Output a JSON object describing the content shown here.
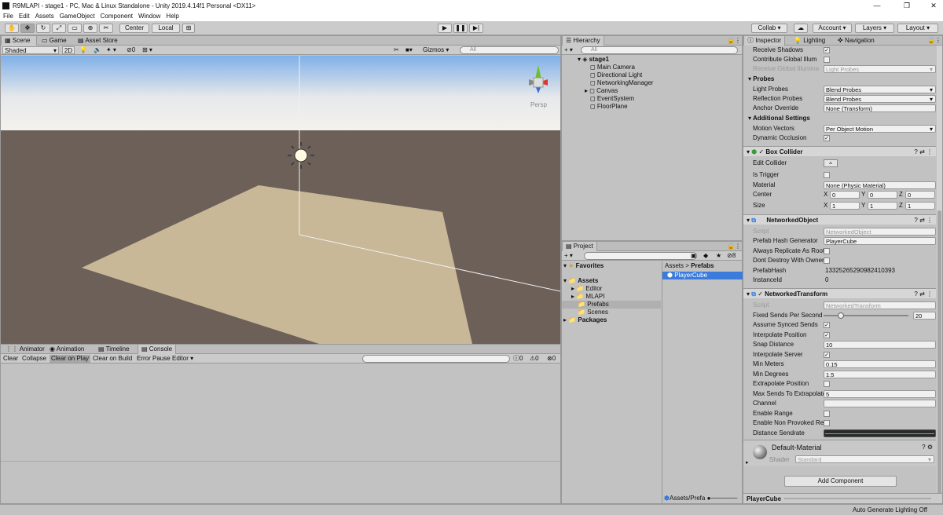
{
  "window": {
    "title": "R9MLAPI - stage1 - PC, Mac & Linux Standalone - Unity 2019.4.14f1 Personal <DX11>",
    "minimize": "—",
    "maximize": "❐",
    "close": "✕"
  },
  "menu": [
    "File",
    "Edit",
    "Assets",
    "GameObject",
    "Component",
    "Window",
    "Help"
  ],
  "toolbar": {
    "center_label": "Center",
    "local_label": "Local",
    "collab_label": "Collab",
    "account_label": "Account",
    "layers_label": "Layers",
    "layout_label": "Layout"
  },
  "scene": {
    "tabs": [
      "Scene",
      "Game",
      "Asset Store"
    ],
    "shading": "Shaded",
    "mode2d": "2D",
    "hidden_count": "0",
    "gizmos": "Gizmos",
    "search_placeholder": "All",
    "persp": "Persp",
    "colors": {
      "sky": "#e6e8ea",
      "ground": "#6c6059",
      "floor": "#c8b898"
    }
  },
  "console": {
    "tabs": [
      "Animator",
      "Animation",
      "Timeline",
      "Console"
    ],
    "buttons": [
      "Clear",
      "Collapse",
      "Clear on Play",
      "Clear on Build",
      "Error Pause",
      "Editor"
    ],
    "info_count": "0",
    "warn_count": "0",
    "error_count": "0"
  },
  "hierarchy": {
    "tab": "Hierarchy",
    "search_placeholder": "All",
    "scene_name": "stage1",
    "items": [
      "Main Camera",
      "Directional Light",
      "NetworkingManager",
      "Canvas",
      "EventSystem",
      "FloorPlane"
    ]
  },
  "project": {
    "tab": "Project",
    "hidden_count": "8",
    "favorites": "Favorites",
    "assets": "Assets",
    "folders": [
      "Editor",
      "MLAPI",
      "Prefabs",
      "Scenes"
    ],
    "packages": "Packages",
    "breadcrumb": [
      "Assets",
      "Prefabs"
    ],
    "selected_item": "PlayerCube",
    "footer_path": "Assets/Prefa"
  },
  "inspector": {
    "tabs": [
      "Inspector",
      "Lighting",
      "Navigation"
    ],
    "renderer_rows": [
      {
        "label": "Receive Shadows",
        "type": "check",
        "value": "✓"
      },
      {
        "label": "Contribute Global Illum",
        "type": "check",
        "value": ""
      },
      {
        "label": "Receive Global Illumina",
        "type": "dropdown",
        "value": "Light Probes",
        "disabled": true
      }
    ],
    "probes": {
      "title": "Probes",
      "light_probes_label": "Light Probes",
      "light_probes_value": "Blend Probes",
      "reflection_probes_label": "Reflection Probes",
      "reflection_probes_value": "Blend Probes",
      "anchor_override_label": "Anchor Override",
      "anchor_override_value": "None (Transform)"
    },
    "additional": {
      "title": "Additional Settings",
      "motion_vectors_label": "Motion Vectors",
      "motion_vectors_value": "Per Object Motion",
      "dynamic_occlusion_label": "Dynamic Occlusion",
      "dynamic_occlusion_value": "✓"
    },
    "box_collider": {
      "title": "Box Collider",
      "edit_label": "Edit Collider",
      "trigger_label": "Is Trigger",
      "material_label": "Material",
      "material_value": "None (Physic Material)",
      "center_label": "Center",
      "center": {
        "x": "0",
        "y": "0",
        "z": "0"
      },
      "size_label": "Size",
      "size": {
        "x": "1",
        "y": "1",
        "z": "1"
      }
    },
    "networked_object": {
      "title": "NetworkedObject",
      "script_label": "Script",
      "script_value": "NetworkedObject",
      "hash_gen_label": "Prefab Hash Generator",
      "hash_gen_value": "PlayerCube",
      "replicate_label": "Always Replicate As Root",
      "dont_destroy_label": "Dont Destroy With Owner",
      "prefab_hash_label": "PrefabHash",
      "prefab_hash_value": "13325265290982410393",
      "instance_id_label": "InstanceId",
      "instance_id_value": "0"
    },
    "networked_transform": {
      "title": "NetworkedTransform",
      "script_label": "Script",
      "script_value": "NetworkedTransform",
      "fixed_sends_label": "Fixed Sends Per Second",
      "fixed_sends_value": "20",
      "fixed_sends_fraction": 0.2,
      "assume_synced_label": "Assume Synced Sends",
      "assume_synced_value": "✓",
      "interp_pos_label": "Interpolate Position",
      "interp_pos_value": "✓",
      "snap_label": "Snap Distance",
      "snap_value": "10",
      "interp_server_label": "Interpolate Server",
      "interp_server_value": "✓",
      "min_meters_label": "Min Meters",
      "min_meters_value": "0.15",
      "min_degrees_label": "Min Degrees",
      "min_degrees_value": "1.5",
      "extrapolate_label": "Extrapolate Position",
      "max_sends_label": "Max Sends To Extrapolate",
      "max_sends_value": "5",
      "channel_label": "Channel",
      "channel_value": "",
      "range_label": "Enable Range",
      "non_provoked_label": "Enable Non Provoked Resend",
      "distance_label": "Distance Sendrate"
    },
    "material": {
      "name": "Default-Material",
      "shader_label": "Shader",
      "shader_value": "Standard"
    },
    "add_component": "Add Component",
    "footer_object": "PlayerCube"
  },
  "status": {
    "right_text": "Auto Generate Lighting Off"
  }
}
